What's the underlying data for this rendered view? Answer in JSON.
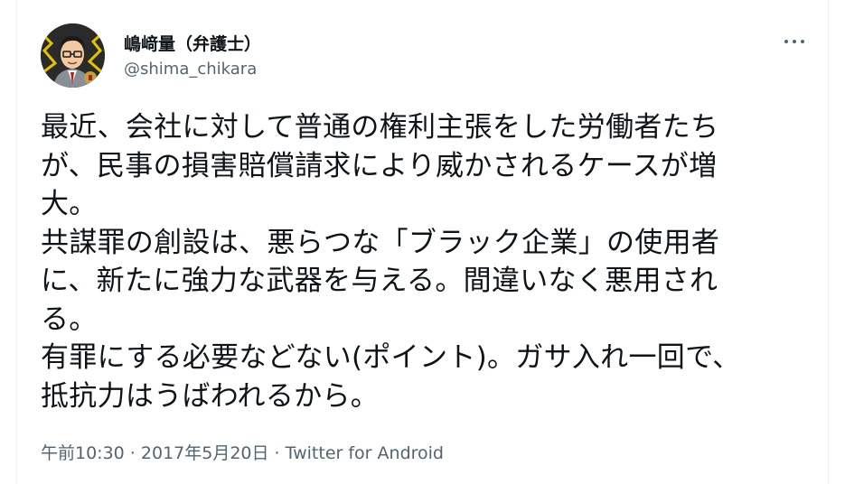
{
  "author": {
    "display_name": "嶋﨑量（弁護士）",
    "handle": "@shima_chikara",
    "avatar_icon": "avatar-portrait-icon"
  },
  "menu": {
    "icon": "more-options-icon"
  },
  "tweet": {
    "lines": [
      "最近、会社に対して普通の権利主張をした労働者たち",
      "が、民事の損害賠償請求により威かされるケースが増",
      "大。",
      "共謀罪の創設は、悪らつな「ブラック企業」の使用者",
      "に、新たに強力な武器を与える。間違いなく悪用され",
      "る。",
      "有罪にする必要などない(ポイント)。ガサ入れ一回で、",
      "抵抗力はうばわれるから。"
    ]
  },
  "meta": {
    "time": "午前10:30",
    "separator_1": " · ",
    "date": "2017年5月20日",
    "separator_2": " · ",
    "source": "Twitter for Android"
  },
  "colors": {
    "text_primary": "#0f1419",
    "text_secondary": "#536471",
    "border": "#eff3f4"
  }
}
